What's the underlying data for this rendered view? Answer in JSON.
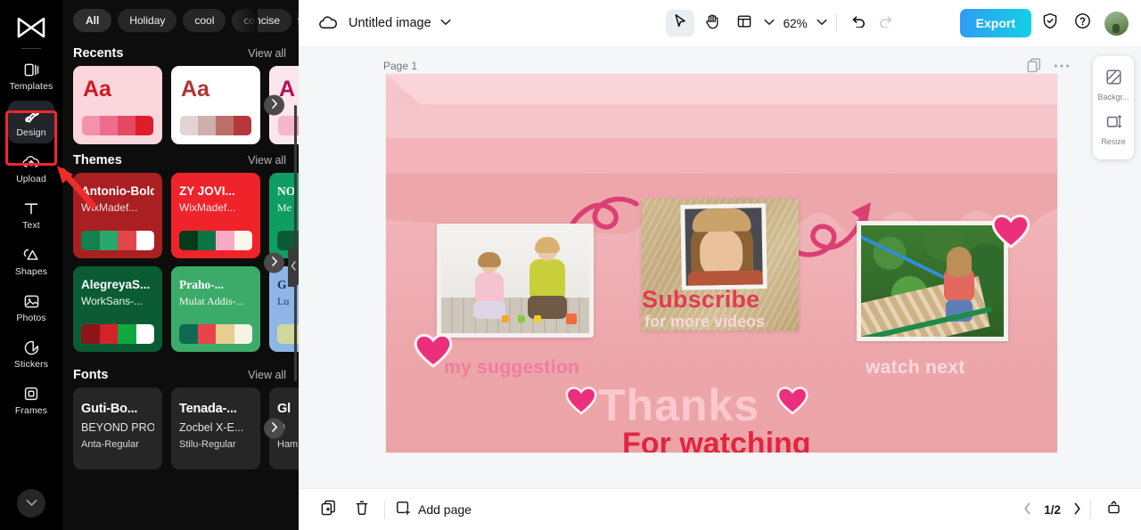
{
  "rail": {
    "logo_icon": "capcut-logo-icon",
    "items": [
      {
        "label": "Templates",
        "icon": "templates-icon",
        "active": false
      },
      {
        "label": "Design",
        "icon": "design-icon",
        "active": true
      },
      {
        "label": "Upload",
        "icon": "upload-icon",
        "active": false
      },
      {
        "label": "Text",
        "icon": "text-icon",
        "active": false
      },
      {
        "label": "Shapes",
        "icon": "shapes-icon",
        "active": false
      },
      {
        "label": "Photos",
        "icon": "photos-icon",
        "active": false
      },
      {
        "label": "Stickers",
        "icon": "stickers-icon",
        "active": false
      },
      {
        "label": "Frames",
        "icon": "frames-icon",
        "active": false
      }
    ],
    "collapse_icon": "chevron-down-icon",
    "highlight_color": "#f42534",
    "annotation_arrow_color": "#ef2b2b"
  },
  "panel": {
    "chips": [
      {
        "label": "All",
        "selected": true
      },
      {
        "label": "Holiday",
        "selected": false
      },
      {
        "label": "cool",
        "selected": false
      },
      {
        "label": "concise",
        "selected": false
      }
    ],
    "chips_more_icon": "chevron-down-icon",
    "sections": [
      {
        "title": "Recents",
        "view_all": "View all"
      },
      {
        "title": "Themes",
        "view_all": "View all"
      },
      {
        "title": "Fonts",
        "view_all": "View all"
      }
    ],
    "recents": [
      {
        "sample": "Aa",
        "bg": "#fbd6dd",
        "text_color": "#cf1b24",
        "swatches": [
          "#f093ab",
          "#ee6d8d",
          "#e5485f",
          "#dd1d27"
        ]
      },
      {
        "sample": "Aa",
        "bg": "#ffffff",
        "text_color": "#b1342f",
        "swatches": [
          "#e3d4d3",
          "#cfb0ad",
          "#bd706a",
          "#b5393a"
        ]
      },
      {
        "sample": "A",
        "bg": "#fae6ec",
        "text_color": "#b01356",
        "swatches": [
          "#f3b7c9",
          "#ef8fae",
          "#e8628a",
          "#e03a67"
        ]
      }
    ],
    "themes": [
      {
        "title": "Antonio-Bold",
        "subtitle": "WixMadef...",
        "bg": "#aa1f22",
        "title_color": "#ffffff",
        "sub_color": "#f3dede",
        "serif": false,
        "swatches": [
          "#12804f",
          "#2aa86b",
          "#e0474c",
          "#ffffff"
        ]
      },
      {
        "title": "ZY JOVI...",
        "subtitle": "WixMadef...",
        "bg": "#f0232b",
        "title_color": "#ffffff",
        "sub_color": "#ffe6e8",
        "serif": false,
        "swatches": [
          "#063a18",
          "#0b7444",
          "#f9a8c6",
          "#fbf7ef"
        ]
      },
      {
        "title": "NO",
        "subtitle": "Me",
        "bg": "#0e9e63",
        "title_color": "#ffffff",
        "sub_color": "#eef7f1",
        "serif": true,
        "swatches": [
          "#0b5c34",
          "#0b5c34",
          "#0b5c34",
          "#0b5c34"
        ]
      },
      {
        "title": "AlegreyaS...",
        "subtitle": "WorkSans-...",
        "bg": "#0b5c34",
        "title_color": "#ffffff",
        "sub_color": "#eaf3ec",
        "serif": false,
        "swatches": [
          "#8f1419",
          "#d32229",
          "#0fa93f",
          "#ffffff"
        ]
      },
      {
        "title": "Praho-...",
        "subtitle": "Mulat Addis-...",
        "bg": "#3cab6a",
        "title_color": "#ffffff",
        "sub_color": "#f2fbf4",
        "serif": true,
        "swatches": [
          "#0f6a54",
          "#e8434b",
          "#e8cd90",
          "#f6f3e2"
        ]
      },
      {
        "title": "G",
        "subtitle": "Lu",
        "bg": "#8fb4e8",
        "title_color": "#16325f",
        "sub_color": "#1c3b68",
        "serif": true,
        "swatches": [
          "#cfd89a",
          "#cfd89a",
          "#cfd89a",
          "#cfd89a"
        ]
      }
    ],
    "fonts": [
      {
        "line1": "Guti-Bo...",
        "line2": "BEYOND PRO...",
        "line3": "Anta-Regular"
      },
      {
        "line1": "Tenada-...",
        "line2": "Zocbel X-E...",
        "line3": "Stilu-Regular"
      },
      {
        "line1": "Gl",
        "line2": "D",
        "line3": "Ham"
      }
    ],
    "carousel_next_icon": "chevron-right-icon",
    "collapse_panel_icon": "chevron-left-icon"
  },
  "topbar": {
    "cloud_icon": "cloud-saved-icon",
    "doc_title": "Untitled image",
    "title_chevron_icon": "chevron-down-icon",
    "tools": [
      {
        "name": "select-tool",
        "icon": "cursor-arrow-icon",
        "active": true
      },
      {
        "name": "hand-tool",
        "icon": "hand-icon",
        "active": false
      },
      {
        "name": "layout-tool",
        "icon": "layout-icon",
        "active": false
      }
    ],
    "layout_chevron_icon": "chevron-down-icon",
    "zoom_value": "62%",
    "zoom_chevron_icon": "chevron-down-icon",
    "undo_icon": "undo-icon",
    "redo_icon": "redo-icon",
    "export_label": "Export",
    "shield_icon": "shield-check-icon",
    "help_icon": "question-mark-icon",
    "avatar_icon": "user-avatar"
  },
  "canvas": {
    "page_label": "Page 1",
    "duplicate_page_icon": "duplicate-page-icon",
    "more_options_icon": "more-horizontal-icon",
    "background_color": "#eda7ab",
    "texts": {
      "suggestion": "my suggestion",
      "subscribe": "Subscribe",
      "subscribe_sub": "for more videos",
      "watch_next": "watch next",
      "thanks": "Thanks",
      "for_watching": "For watching"
    },
    "accent_pink": "#e8417a",
    "arrow_color": "#dc3f74"
  },
  "rightpanel": {
    "items": [
      {
        "label": "Backgr...",
        "icon": "background-icon"
      },
      {
        "label": "Resize",
        "icon": "resize-icon"
      }
    ]
  },
  "bottombar": {
    "duplicate_icon": "duplicate-icon",
    "delete_icon": "trash-icon",
    "add_page_label": "Add page",
    "add_page_icon": "add-page-icon",
    "prev_icon": "chevron-left-icon",
    "page_indicator": "1/2",
    "next_icon": "chevron-right-icon",
    "fit_icon": "fit-screen-icon"
  }
}
